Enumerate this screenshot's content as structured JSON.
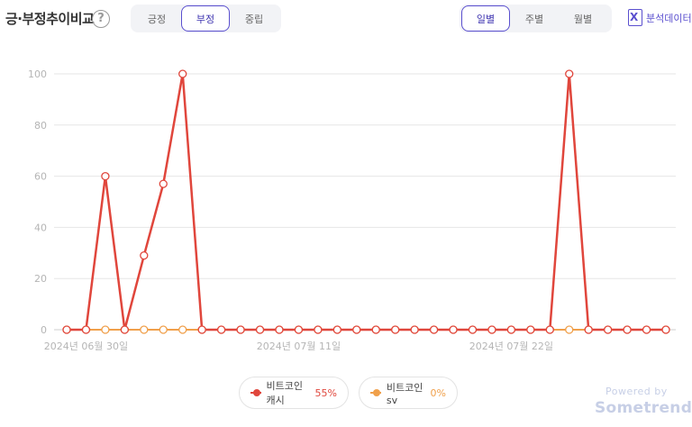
{
  "header": {
    "title": "긍·부정추이비교",
    "help_icon": "question-circle-icon",
    "sentiment_tabs": [
      {
        "label": "긍정",
        "active": false
      },
      {
        "label": "부정",
        "active": true
      },
      {
        "label": "중립",
        "active": false
      }
    ],
    "period_tabs": [
      {
        "label": "일별",
        "active": true
      },
      {
        "label": "주별",
        "active": false
      },
      {
        "label": "월별",
        "active": false
      }
    ],
    "export_label": "분석데이터",
    "export_icon": "excel-icon"
  },
  "colors": {
    "accent": "#5a4fcf",
    "series1": "#e0463c",
    "series2": "#f0a04b",
    "grid": "#e6e6e6",
    "axis_text": "#b5b5b5"
  },
  "chart_data": {
    "type": "line",
    "x": [
      "2024-06-29",
      "2024-06-30",
      "2024-07-01",
      "2024-07-02",
      "2024-07-03",
      "2024-07-04",
      "2024-07-05",
      "2024-07-06",
      "2024-07-07",
      "2024-07-08",
      "2024-07-09",
      "2024-07-10",
      "2024-07-11",
      "2024-07-12",
      "2024-07-13",
      "2024-07-14",
      "2024-07-15",
      "2024-07-16",
      "2024-07-17",
      "2024-07-18",
      "2024-07-19",
      "2024-07-20",
      "2024-07-21",
      "2024-07-22",
      "2024-07-23",
      "2024-07-24",
      "2024-07-25",
      "2024-07-26",
      "2024-07-27",
      "2024-07-28",
      "2024-07-29",
      "2024-07-30"
    ],
    "x_tick_labels": [
      {
        "at": "2024-06-30",
        "label": "2024년 06월 30일"
      },
      {
        "at": "2024-07-11",
        "label": "2024년 07월 11일"
      },
      {
        "at": "2024-07-22",
        "label": "2024년 07월 22일"
      }
    ],
    "series": [
      {
        "name": "비트코인캐시",
        "percent": "55%",
        "values": [
          0,
          0,
          60,
          0,
          29,
          57,
          100,
          0,
          0,
          0,
          0,
          0,
          0,
          0,
          0,
          0,
          0,
          0,
          0,
          0,
          0,
          0,
          0,
          0,
          0,
          0,
          100,
          0,
          0,
          0,
          0,
          0
        ]
      },
      {
        "name": "비트코인sv",
        "percent": "0%",
        "values": [
          0,
          0,
          0,
          0,
          0,
          0,
          0,
          0,
          0,
          0,
          0,
          0,
          0,
          0,
          0,
          0,
          0,
          0,
          0,
          0,
          0,
          0,
          0,
          0,
          0,
          0,
          0,
          0,
          0,
          0,
          0,
          0
        ]
      }
    ],
    "y_ticks": [
      "0",
      "20",
      "40",
      "60",
      "80",
      "100"
    ],
    "ylim": [
      0,
      100
    ],
    "grid": true,
    "legend_position": "bottom"
  },
  "footer": {
    "powered_by": "Powered by",
    "brand": "Sometrend"
  }
}
